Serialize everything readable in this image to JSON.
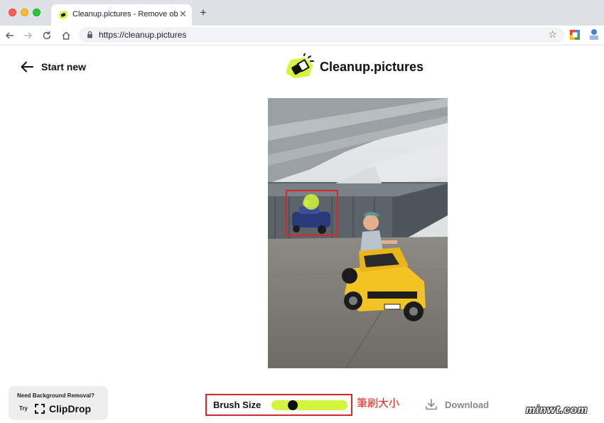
{
  "browser": {
    "tab_title": "Cleanup.pictures - Remove obj",
    "tab_close": "✕",
    "new_tab": "+",
    "url": "https://cleanup.pictures",
    "star": "☆"
  },
  "header": {
    "start_new_label": "Start new",
    "logo_text": "Cleanup.pictures"
  },
  "editor": {
    "brush_size_label": "Brush Size",
    "brush_size_level": 0.25,
    "accent_color": "#d3f53d",
    "annotation_text": "筆刷大小",
    "download_label": "Download"
  },
  "promo": {
    "top_text": "Need Background Removal?",
    "try_label": "Try",
    "product_name": "ClipDrop"
  },
  "watermark": "minwt.com",
  "icons": {
    "back": "back-arrow-icon",
    "forward": "forward-arrow-icon",
    "reload": "reload-icon",
    "home": "home-icon",
    "lock": "lock-icon",
    "bookmark": "star-icon",
    "start_new": "left-arrow-icon",
    "logo": "eraser-logo-icon",
    "download": "download-icon",
    "clipdrop": "clipdrop-icon"
  }
}
